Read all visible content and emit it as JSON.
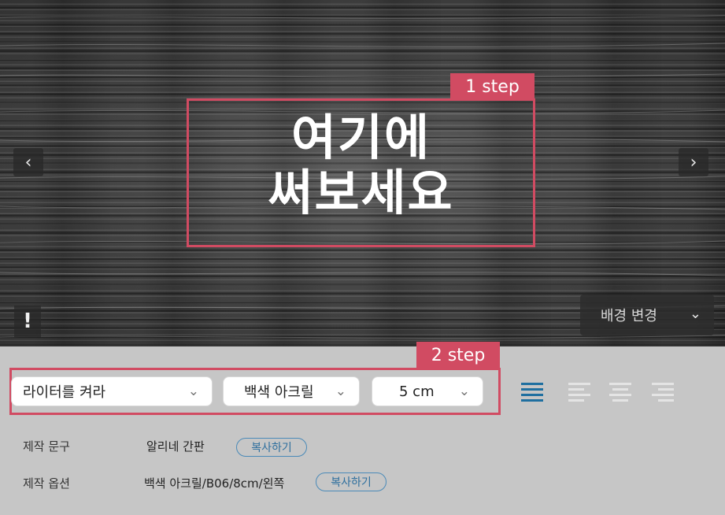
{
  "preview": {
    "sign_line1": "여기에",
    "sign_line2": "써보세요",
    "step1_label": "1 step",
    "prev_icon": "chevron-left-icon",
    "next_icon": "chevron-right-icon",
    "info_icon": "exclamation-icon",
    "background_button": "배경 변경"
  },
  "options": {
    "step2_label": "2 step",
    "font_select": "라이터를 켜라",
    "material_select": "백색 아크릴",
    "size_select": "5 cm",
    "alignments": [
      "align-justify-icon",
      "align-left-icon",
      "align-center-icon",
      "align-right-icon"
    ],
    "active_alignment": "align-justify-icon",
    "accent_color": "#1f6fa0",
    "step_color": "#d14b62"
  },
  "info": {
    "text_label": "제작 문구",
    "text_value": "알리네 간판",
    "option_label": "제작 옵션",
    "option_value": "백색 아크릴/B06/8cm/왼쪽",
    "copy_button": "복사하기"
  }
}
